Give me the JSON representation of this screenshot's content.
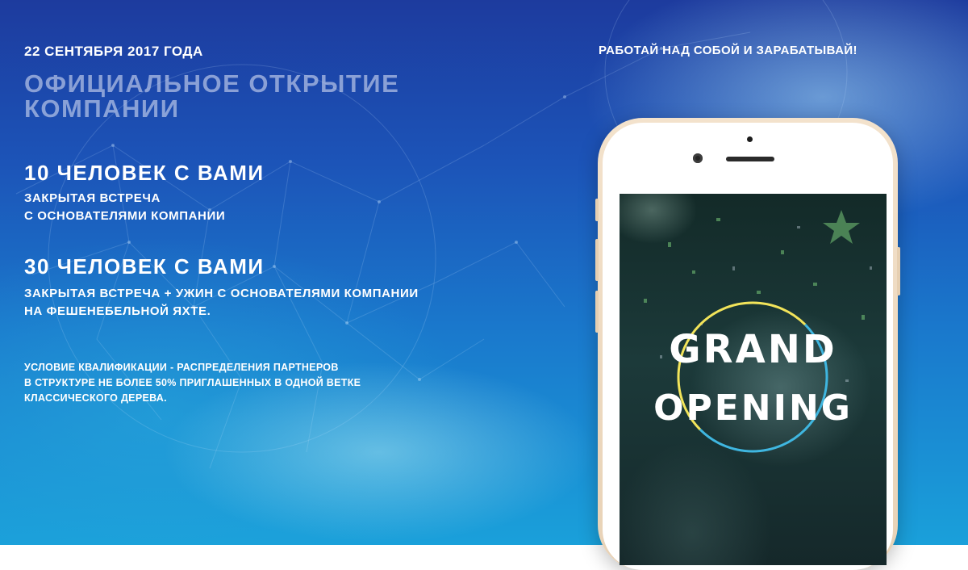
{
  "date": "22 СЕНТЯБРЯ 2017 ГОДА",
  "headline": [
    "ОФИЦИАЛЬНОЕ ОТКРЫТИЕ",
    "КОМПАНИИ"
  ],
  "offers": [
    {
      "title": "10 ЧЕЛОВЕК С ВАМИ",
      "lines": [
        "ЗАКРЫТАЯ ВСТРЕЧА",
        "С ОСНОВАТЕЛЯМИ КОМПАНИИ"
      ]
    },
    {
      "title": "30 ЧЕЛОВЕК С ВАМИ",
      "lines": [
        "ЗАКРЫТАЯ ВСТРЕЧА + УЖИН С ОСНОВАТЕЛЯМИ КОМПАНИИ",
        "НА ФЕШЕНЕБЕЛЬНОЙ ЯХТЕ."
      ]
    }
  ],
  "condition": [
    "УСЛОВИЕ КВАЛИФИКАЦИИ - РАСПРЕДЕЛЕНИЯ ПАРТНЕРОВ",
    "В СТРУКТУРЕ НЕ БОЛЕЕ 50% ПРИГЛАШЕННЫХ В ОДНОЙ ВЕТКЕ",
    "КЛАССИЧЕСКОГО ДЕРЕВА."
  ],
  "slogan": "РАБОТАЙ НАД СОБОЙ И ЗАРАБАТЫВАЙ!",
  "phone_screen": {
    "line1": "GRAND",
    "line2": "OPENING",
    "ring_colors": [
      "#f2e45a",
      "#3fb6e0"
    ]
  },
  "colors": {
    "background_top": "#1d3b9e",
    "background_bottom": "#1aa0da",
    "headline": "#cdd7f0",
    "phone_frame": "#f3e2cc"
  }
}
